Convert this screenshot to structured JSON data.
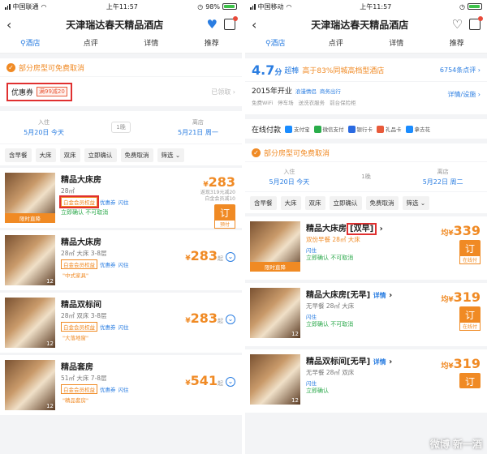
{
  "left": {
    "status": {
      "carrier": "中国联通",
      "time": "上午11:57",
      "battery": "98%"
    },
    "title": "天津瑞达春天精品酒店",
    "tabs": [
      "酒店",
      "点评",
      "详情",
      "推荐"
    ],
    "banner": "部分房型可免费取消",
    "coupon": {
      "label": "优惠券",
      "tag": "满99减20",
      "right": "已领取"
    },
    "dates": {
      "in_label": "入住",
      "in_value": "5月20日 今天",
      "nights": "1晚",
      "out_label": "离店",
      "out_value": "5月21日 周一"
    },
    "filters": [
      "含早餐",
      "大床",
      "双床",
      "立即确认",
      "免费取消",
      "筛选"
    ],
    "rooms": [
      {
        "name": "精品大床房",
        "sub": "28㎡",
        "tag1": "白金会员权益",
        "tag2": "优惠券",
        "tag3": "闪住",
        "extra": "立即确认  不可取消",
        "price": "283",
        "note1": "返现319元减20",
        "note2": "白金会员减10",
        "book": "订",
        "book_sub": "预付",
        "ribbon": "限时直降",
        "count": "12"
      },
      {
        "name": "精品大床房",
        "sub": "28㎡ 大床 3-8层",
        "tag1": "白金会员权益",
        "tag2": "优惠券",
        "tag3": "闪住",
        "extra": "\"中式家具\"",
        "price": "283",
        "suffix": "起",
        "count": "12"
      },
      {
        "name": "精品双标间",
        "sub": "28㎡ 双床 3-8层",
        "tag1": "白金会员权益",
        "tag2": "优惠券",
        "tag3": "闪住",
        "extra": "\"大落地窗\"",
        "price": "283",
        "suffix": "起",
        "count": "12"
      },
      {
        "name": "精品套房",
        "sub": "51㎡ 大床 7-8层",
        "tag1": "白金会员权益",
        "tag2": "优惠券",
        "tag3": "闪住",
        "extra": "\"精品套房\"",
        "price": "541",
        "suffix": "起",
        "count": "12"
      }
    ]
  },
  "right": {
    "status": {
      "carrier": "中国移动",
      "time": "上午11:57"
    },
    "title": "天津瑞达春天精品酒店",
    "tabs": [
      "酒店",
      "点评",
      "详情",
      "推荐"
    ],
    "score": {
      "value": "4.7",
      "unit": "分",
      "level": "超棒",
      "desc": "高于83%同城高档型酒店",
      "reviews": "6754条点评"
    },
    "info": {
      "year": "2015年开业",
      "tag1": "浪漫情侣",
      "tag2": "商务出行",
      "facilities": [
        "免费WiFi",
        "停车场",
        "送洗衣服务",
        "前台保险柜"
      ],
      "link": "详情/设施"
    },
    "pay": {
      "label": "在线付款",
      "methods": [
        "支付宝",
        "微信支付",
        "银行卡",
        "礼品卡",
        "拿去花"
      ]
    },
    "banner": "部分房型可免费取消",
    "dates": {
      "in_label": "入住",
      "in_value": "5月20日 今天",
      "nights": "1晚",
      "out_label": "离店",
      "out_value": "5月22日 周二"
    },
    "filters": [
      "含早餐",
      "大床",
      "双床",
      "立即确认",
      "免费取消",
      "筛选"
    ],
    "rooms": [
      {
        "name": "精品大床房",
        "bracket": "[双早]",
        "sub": "双份早餐  28㎡  大床",
        "tag": "闪住",
        "extra": "立即确认  不可取消",
        "prefix": "均¥",
        "price": "339",
        "book": "订",
        "book_sub": "在线付",
        "ribbon": "限时直降",
        "count": "12"
      },
      {
        "name": "精品大床房[无早]",
        "link": "详情",
        "sub": "无早餐  28㎡  大床",
        "tag": "闪住",
        "extra": "立即确认  不可取消",
        "prefix": "均¥",
        "price": "319",
        "book": "订",
        "book_sub": "在线付",
        "count": "12"
      },
      {
        "name": "精品双标间[无早]",
        "link": "详情",
        "sub": "无早餐  28㎡  双床",
        "tag": "闪住",
        "extra": "立即确认",
        "prefix": "均¥",
        "price": "319",
        "book": "订",
        "count": "12"
      }
    ],
    "watermark": "微博 新一酒"
  }
}
